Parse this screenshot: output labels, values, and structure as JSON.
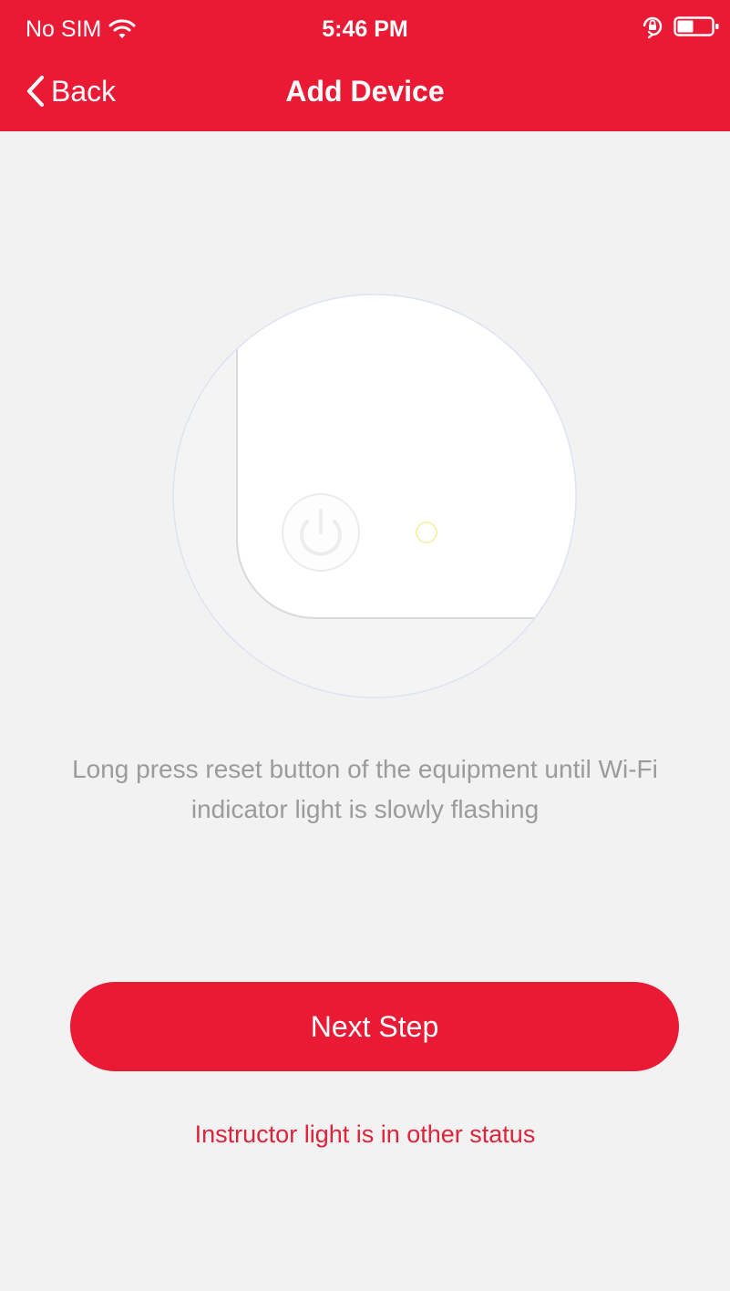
{
  "status_bar": {
    "carrier": "No SIM",
    "time": "5:46 PM",
    "icons": [
      "wifi-icon",
      "orientation-lock-icon",
      "battery-icon"
    ]
  },
  "nav": {
    "back_label": "Back",
    "title": "Add Device"
  },
  "illustration": {
    "icons": [
      "device-illustration",
      "power-button-icon",
      "indicator-light-icon"
    ]
  },
  "instruction": "Long press reset button of the equipment  until Wi-Fi indicator light is slowly flashing",
  "primary_button": "Next Step",
  "secondary_link": "Instructor light is in other status",
  "colors": {
    "accent": "#ea1a34",
    "background": "#f2f2f2",
    "instruction_text": "#9b9b9b",
    "link_text": "#e0223a",
    "indicator_light": "#f3f2b0"
  }
}
